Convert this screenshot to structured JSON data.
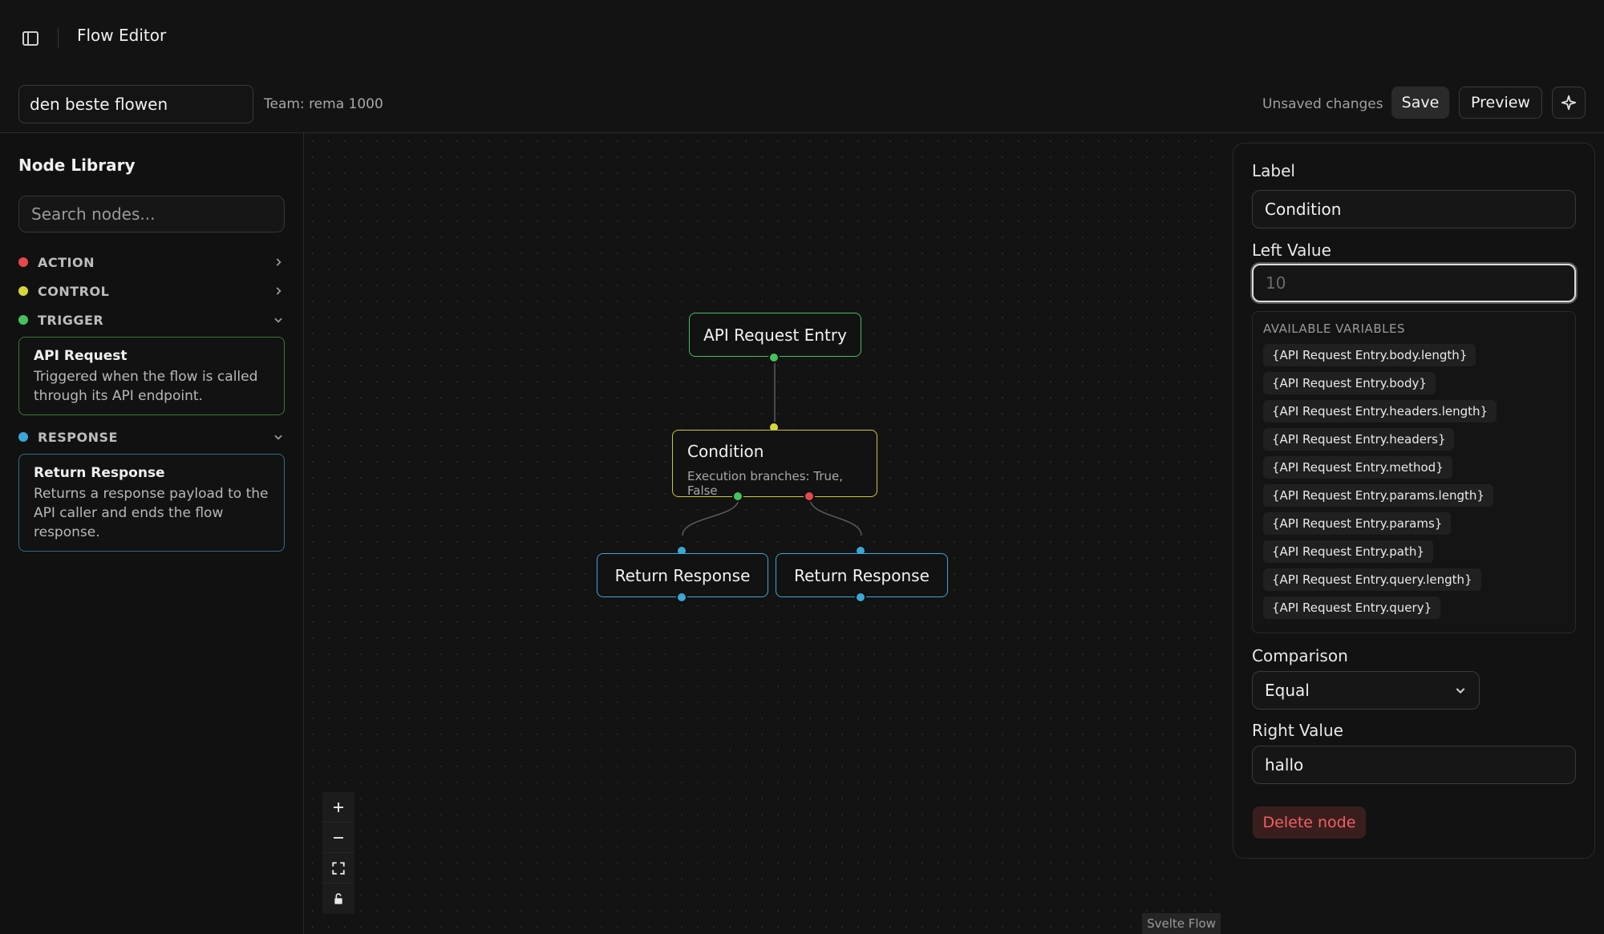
{
  "app": {
    "title": "Flow Editor"
  },
  "toolbar": {
    "flow_name": "den beste flowen",
    "team": "Team: rema 1000",
    "status": "Unsaved changes",
    "save_label": "Save",
    "preview_label": "Preview"
  },
  "sidebar": {
    "title": "Node Library",
    "search_placeholder": "Search nodes...",
    "categories": [
      {
        "label": "ACTION",
        "color": "#e5484d",
        "expanded": false
      },
      {
        "label": "CONTROL",
        "color": "#d6d63a",
        "expanded": false
      },
      {
        "label": "TRIGGER",
        "color": "#46c15e",
        "expanded": true,
        "items": [
          {
            "title": "API Request",
            "description": "Triggered when the flow is called through its API endpoint.",
            "border": "#2e7d3a"
          }
        ]
      },
      {
        "label": "RESPONSE",
        "color": "#3aa7d6",
        "expanded": true,
        "items": [
          {
            "title": "Return Response",
            "description": "Returns a response payload to the API caller and ends the flow response.",
            "border": "#2a6f8f"
          }
        ]
      }
    ]
  },
  "canvas": {
    "nodes": [
      {
        "id": "entry",
        "title": "API Request Entry",
        "subtitle": "",
        "border": "#46c15e"
      },
      {
        "id": "condition",
        "title": "Condition",
        "subtitle": "Execution branches: True, False",
        "border": "#c8c83a"
      },
      {
        "id": "resp1",
        "title": "Return Response",
        "subtitle": "",
        "border": "#3aa7d6"
      },
      {
        "id": "resp2",
        "title": "Return Response",
        "subtitle": "",
        "border": "#3aa7d6"
      }
    ],
    "attribution": "Svelte Flow"
  },
  "panel": {
    "label_title": "Label",
    "label_value": "Condition",
    "left_title": "Left Value",
    "left_placeholder": "10",
    "variables_heading": "AVAILABLE VARIABLES",
    "variables": [
      "{API Request Entry.body.length}",
      "{API Request Entry.body}",
      "{API Request Entry.headers.length}",
      "{API Request Entry.headers}",
      "{API Request Entry.method}",
      "{API Request Entry.params.length}",
      "{API Request Entry.params}",
      "{API Request Entry.path}",
      "{API Request Entry.query.length}",
      "{API Request Entry.query}"
    ],
    "comparison_title": "Comparison",
    "comparison_value": "Equal",
    "right_title": "Right Value",
    "right_value": "hallo",
    "delete_label": "Delete node"
  },
  "colors": {
    "green": "#46c15e",
    "yellow": "#d6d63a",
    "red": "#e5484d",
    "blue": "#3aa7d6",
    "delete": "#f06060"
  }
}
